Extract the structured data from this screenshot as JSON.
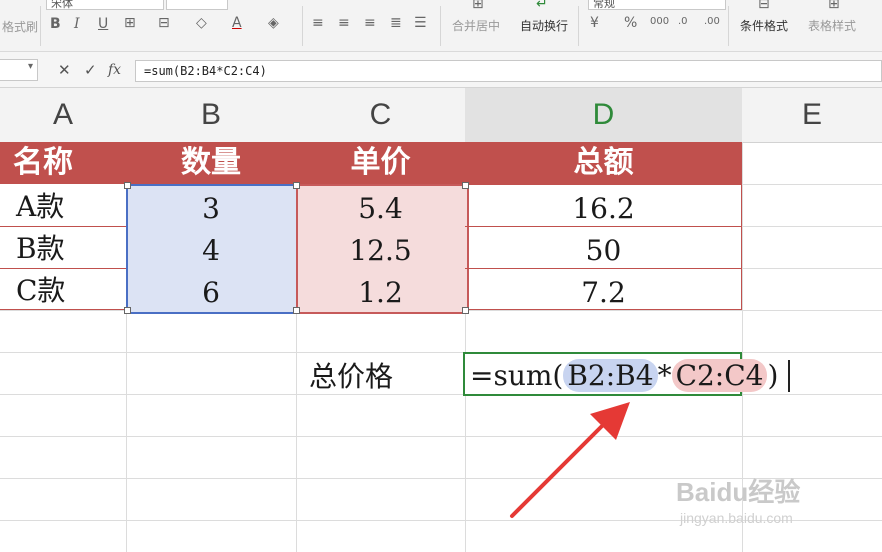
{
  "ribbon": {
    "font_name": "宋体",
    "merge_center": "合并居中",
    "auto_wrap": "自动换行",
    "number_format": "常规",
    "conditional_format": "条件格式",
    "table_style": "表格样式",
    "format_painter": "格式刷"
  },
  "formula_bar": {
    "fx_label": "fx",
    "formula": "=sum(B2:B4*C2:C4)"
  },
  "columns": [
    "A",
    "B",
    "C",
    "D",
    "E"
  ],
  "table": {
    "headers": [
      "名称",
      "数量",
      "单价",
      "总额"
    ],
    "rows": [
      [
        "A款",
        "3",
        "5.4",
        "16.2"
      ],
      [
        "B款",
        "4",
        "12.5",
        "50"
      ],
      [
        "C款",
        "6",
        "1.2",
        "7.2"
      ]
    ]
  },
  "total": {
    "label": "总价格",
    "edit_prefix": "=sum(",
    "ref1": "B2:B4",
    "operator": "*",
    "ref2": "C2:C4",
    "edit_suffix": ")"
  },
  "watermark": {
    "brand": "Baidu经验",
    "url": "jingyan.baidu.com"
  },
  "colors": {
    "header_fill": "#c0504d",
    "ref_blue": "#4a6fc4",
    "ref_red": "#c65a5a",
    "edit_border": "#2f8a3a",
    "arrow": "#e53935"
  }
}
